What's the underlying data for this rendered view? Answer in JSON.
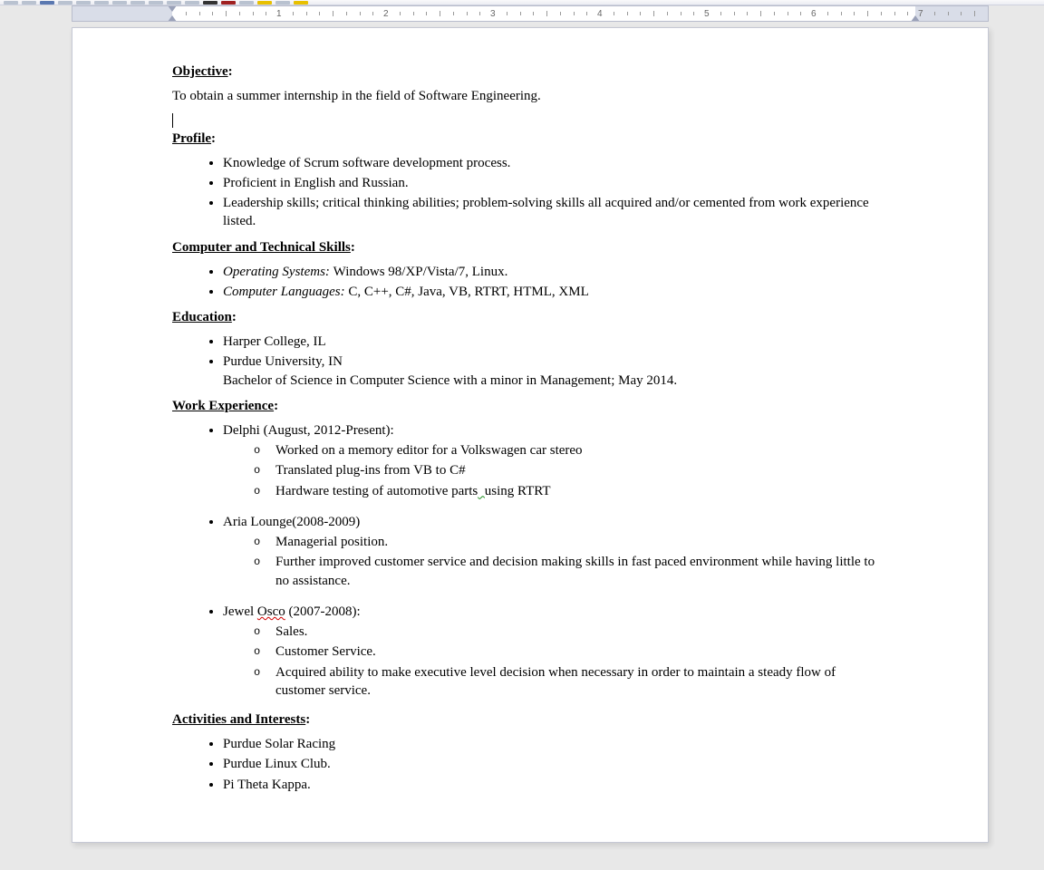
{
  "ruler": {
    "numbers": [
      "1",
      "2",
      "3",
      "4",
      "5",
      "6",
      "7"
    ],
    "leftMarginPx": 110,
    "rightMarginPx": 80,
    "inchPx": 118
  },
  "resume": {
    "objective": {
      "heading": "Objective",
      "text": "To obtain a summer internship in the field of Software Engineering."
    },
    "profile": {
      "heading": "Profile",
      "items": [
        "Knowledge of Scrum software development process.",
        "Proficient in English and Russian.",
        "Leadership skills; critical thinking abilities; problem-solving skills all acquired and/or cemented from work experience listed."
      ]
    },
    "skills": {
      "heading": "Computer and Technical Skills",
      "items": [
        {
          "label": "Operating Systems:",
          "value": "Windows 98/XP/Vista/7, Linux."
        },
        {
          "label": "Computer Languages:",
          "value": "C, C++, C#, Java, VB, RTRT, HTML, XML"
        }
      ]
    },
    "education": {
      "heading": "Education",
      "items": [
        {
          "line": "Harper College, IL"
        },
        {
          "line": "Purdue University, IN",
          "sub": "Bachelor of Science in Computer Science with a minor in Management; May 2014."
        }
      ]
    },
    "work": {
      "heading": "Work Experience",
      "jobs": [
        {
          "title": "Delphi (August, 2012-Present):",
          "details": [
            "Worked on a memory editor for a Volkswagen car stereo",
            "Translated plug-ins from VB to C#",
            "Hardware testing of automotive parts  using RTRT"
          ]
        },
        {
          "title": "Aria Lounge(2008-2009)",
          "details": [
            "Managerial position.",
            "Further improved customer service and decision making skills in fast paced environment while having little to no assistance."
          ]
        },
        {
          "title_parts": {
            "pre": "Jewel ",
            "wavy": "Osco",
            "post": " (2007-2008):"
          },
          "details": [
            "Sales.",
            "Customer Service.",
            "Acquired ability to make executive level decision when necessary in order to maintain a steady flow of customer service."
          ]
        }
      ]
    },
    "activities": {
      "heading": "Activities and Interests",
      "items": [
        "Purdue Solar Racing",
        "Purdue Linux Club.",
        "Pi Theta Kappa."
      ]
    }
  }
}
